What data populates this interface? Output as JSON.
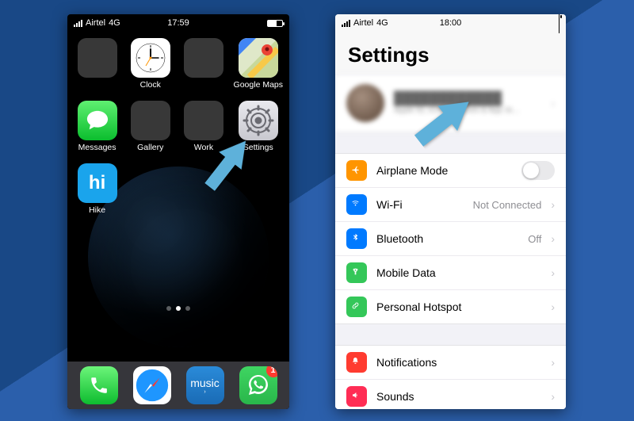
{
  "phone1": {
    "status": {
      "carrier": "Airtel",
      "network": "4G",
      "time": "17:59"
    },
    "apps": [
      {
        "id": "folder-media",
        "label": "",
        "type": "folder"
      },
      {
        "id": "clock",
        "label": "Clock"
      },
      {
        "id": "folder-util",
        "label": "",
        "type": "folder"
      },
      {
        "id": "maps",
        "label": "Google Maps"
      },
      {
        "id": "messages",
        "label": "Messages"
      },
      {
        "id": "gallery",
        "label": "Gallery",
        "type": "folder"
      },
      {
        "id": "work",
        "label": "Work",
        "type": "folder"
      },
      {
        "id": "settings",
        "label": "Settings"
      },
      {
        "id": "hike",
        "label": "Hike"
      }
    ],
    "dock": [
      {
        "id": "phone",
        "label": "Phone"
      },
      {
        "id": "safari",
        "label": "Safari"
      },
      {
        "id": "music",
        "label": "music"
      },
      {
        "id": "whatsapp",
        "label": "WhatsApp",
        "badge": "1"
      }
    ],
    "pager_count": 3,
    "pager_active": 1
  },
  "phone2": {
    "status": {
      "carrier": "Airtel",
      "network": "4G",
      "time": "18:00"
    },
    "title": "Settings",
    "account": {
      "name": "████████████",
      "subtitle": "Apple ID, iCloud, iTunes & App St…"
    },
    "group1": [
      {
        "icon": "airplane",
        "color": "#ff9500",
        "label": "Airplane Mode",
        "control": "switch"
      },
      {
        "icon": "wifi",
        "color": "#007aff",
        "label": "Wi-Fi",
        "value": "Not Connected"
      },
      {
        "icon": "bluetooth",
        "color": "#007aff",
        "label": "Bluetooth",
        "value": "Off"
      },
      {
        "icon": "antenna",
        "color": "#34c759",
        "label": "Mobile Data"
      },
      {
        "icon": "link",
        "color": "#34c759",
        "label": "Personal Hotspot"
      }
    ],
    "group2": [
      {
        "icon": "bell",
        "color": "#ff3b30",
        "label": "Notifications"
      },
      {
        "icon": "sound",
        "color": "#ff2d55",
        "label": "Sounds"
      }
    ]
  }
}
